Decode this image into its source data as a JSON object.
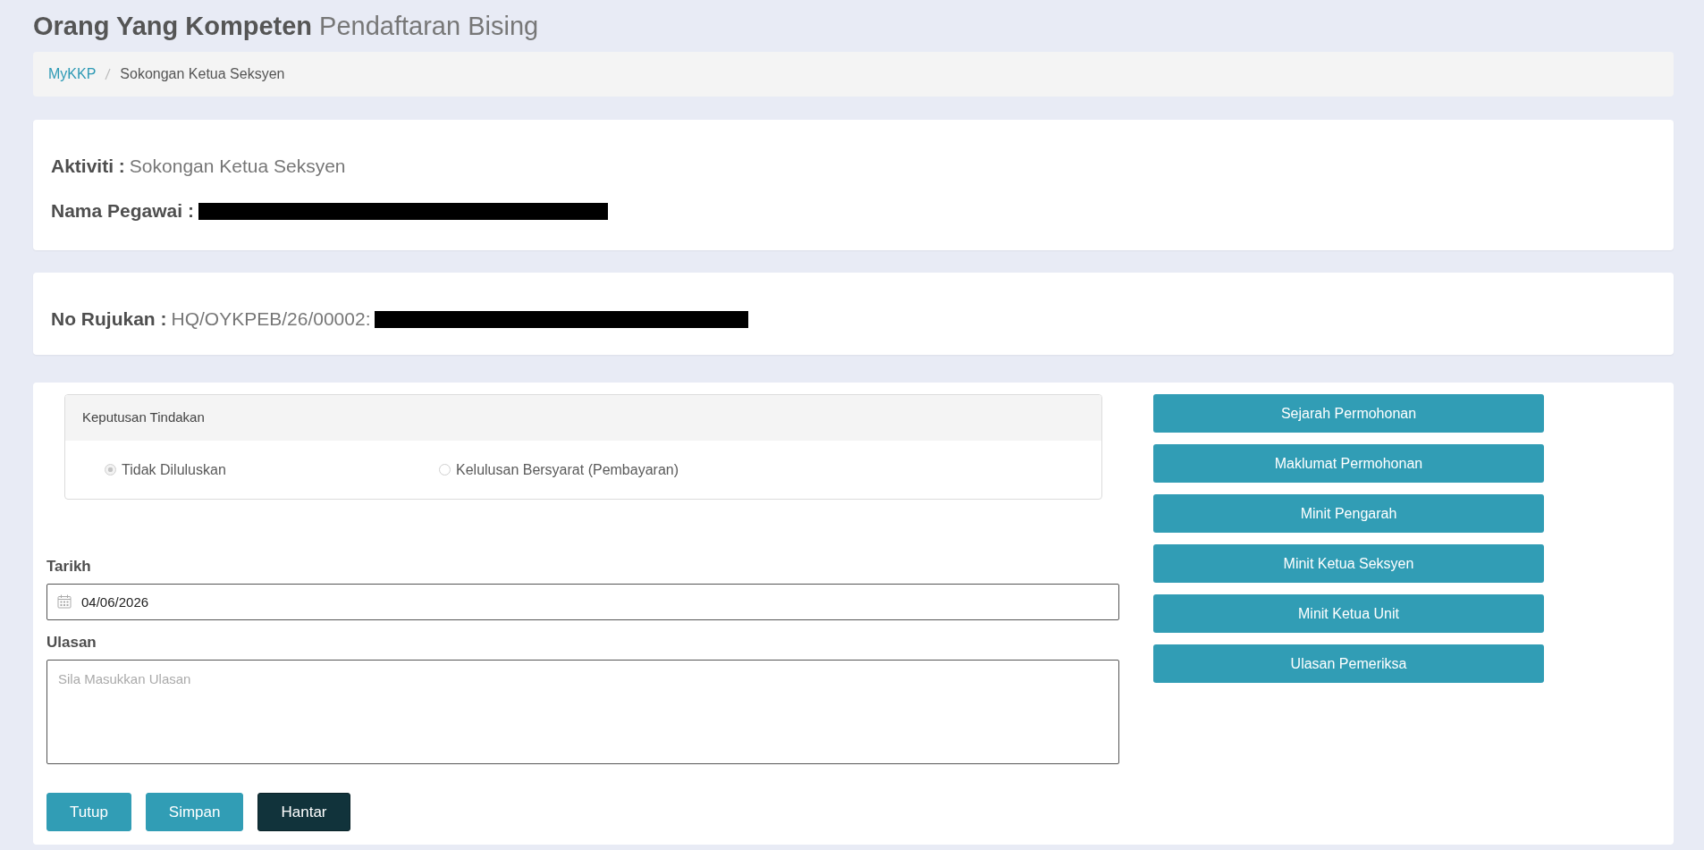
{
  "page_title": {
    "main": "Orang Yang Kompeten",
    "sub": "Pendaftaran Bising"
  },
  "breadcrumb": [
    {
      "label": "MyKKP",
      "kind": "link"
    },
    {
      "label": "Sokongan Ketua Seksyen",
      "kind": "current"
    }
  ],
  "info_cards": [
    {
      "fields": [
        {
          "label": "Aktiviti :",
          "value": "Sokongan Ketua Seksyen"
        },
        {
          "label": "Nama Pegawai :",
          "redacted": true
        }
      ]
    },
    {
      "fields": [
        {
          "label": "No Rujukan :",
          "value": "HQ/OYKPEB/26/00002:",
          "redacted": true
        }
      ]
    }
  ],
  "decision_panel": {
    "title": "Keputusan Tindakan",
    "options": [
      {
        "label": "Tidak Diluluskan",
        "selected": true,
        "disabled": true
      },
      {
        "label": "Kelulusan Bersyarat (Pembayaran)",
        "selected": false,
        "disabled": true
      }
    ]
  },
  "form": {
    "date": {
      "label": "Tarikh",
      "value": "04/06/2026"
    },
    "remarks": {
      "label": "Ulasan",
      "placeholder": "Sila Masukkan Ulasan"
    }
  },
  "actions": [
    {
      "label": "Tutup",
      "kind": "info"
    },
    {
      "label": "Simpan",
      "kind": "info"
    },
    {
      "label": "Hantar",
      "kind": "dark"
    }
  ],
  "side_buttons": [
    "Sejarah Permohonan",
    "Maklumat Permohonan",
    "Minit Pengarah",
    "Minit Ketua Seksyen",
    "Minit Ketua Unit",
    "Ulasan Pemeriksa"
  ]
}
